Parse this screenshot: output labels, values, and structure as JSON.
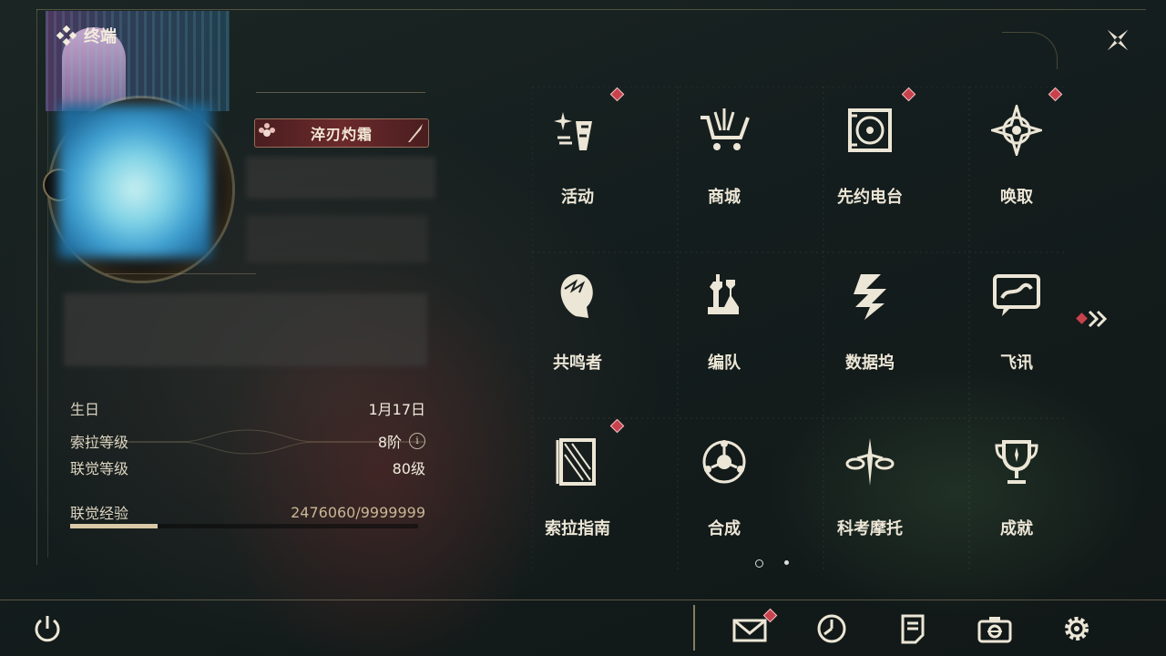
{
  "header": {
    "title": "终端",
    "title_icon": "diamond-cluster-icon",
    "close_icon": "close-star-icon"
  },
  "profile": {
    "tag": "淬刃灼霜",
    "fields": [
      {
        "label": "生日",
        "value": "1月17日"
      },
      {
        "label": "索拉等级",
        "value": "8阶",
        "info_icon": "i"
      },
      {
        "label": "联觉等级",
        "value": "80级"
      },
      {
        "label": "联觉经验",
        "value": "2476060/9999999"
      }
    ],
    "exp_fraction": 0.25
  },
  "menu": {
    "items": [
      {
        "label": "活动",
        "icon": "sparkle-flag-icon",
        "badge": true
      },
      {
        "label": "商城",
        "icon": "shopping-cart-icon",
        "badge": false
      },
      {
        "label": "先约电台",
        "icon": "radio-record-icon",
        "badge": true
      },
      {
        "label": "唤取",
        "icon": "compass-star-icon",
        "badge": true
      },
      {
        "label": "共鸣者",
        "icon": "character-head-icon",
        "badge": false
      },
      {
        "label": "编队",
        "icon": "chess-pieces-icon",
        "badge": false
      },
      {
        "label": "数据坞",
        "icon": "data-dock-icon",
        "badge": false
      },
      {
        "label": "飞讯",
        "icon": "chat-bubble-icon",
        "badge": false
      },
      {
        "label": "索拉指南",
        "icon": "guide-book-icon",
        "badge": true
      },
      {
        "label": "合成",
        "icon": "synthesis-orb-icon",
        "badge": false
      },
      {
        "label": "科考摩托",
        "icon": "motorbike-icon",
        "badge": false
      },
      {
        "label": "成就",
        "icon": "trophy-icon",
        "badge": false
      }
    ],
    "page_current": 1,
    "page_total": 2,
    "next_page_icon": "double-chevron-right-icon"
  },
  "bottom_bar": {
    "power_icon": "power-icon",
    "actions": [
      {
        "icon": "mail-icon",
        "badge": true
      },
      {
        "icon": "clock-icon",
        "badge": false
      },
      {
        "icon": "notes-icon",
        "badge": false
      },
      {
        "icon": "camera-icon",
        "badge": false
      },
      {
        "icon": "settings-gear-icon",
        "badge": false
      }
    ]
  },
  "colors": {
    "accent": "#c8424e",
    "gold": "#c9b694",
    "text": "#ece6d6"
  }
}
